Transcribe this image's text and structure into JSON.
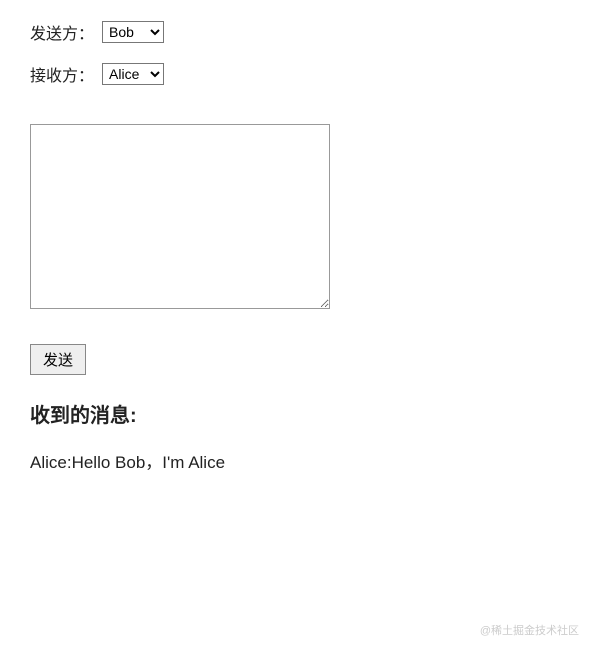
{
  "form": {
    "sender": {
      "label": "发送方：",
      "selected": "Bob"
    },
    "receiver": {
      "label": "接收方：",
      "selected": "Alice"
    },
    "message": {
      "value": ""
    },
    "send_button": "发送"
  },
  "received": {
    "heading": "收到的消息:",
    "messages": [
      "Alice:Hello Bob，I'm Alice"
    ]
  },
  "watermark": "@稀土掘金技术社区"
}
